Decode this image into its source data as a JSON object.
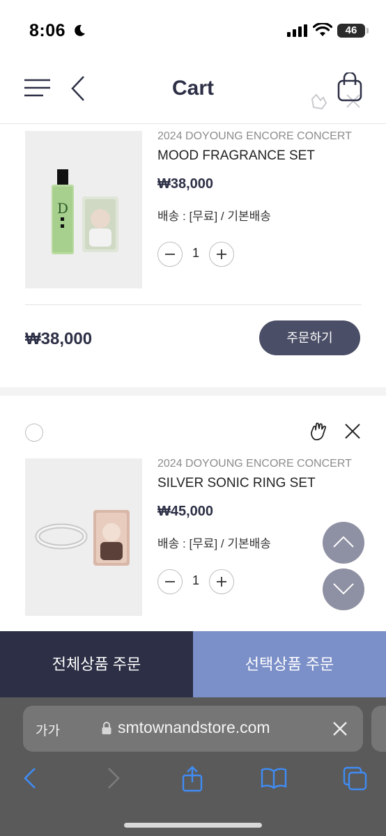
{
  "status_bar": {
    "time": "8:06",
    "battery": "46"
  },
  "header": {
    "title": "Cart"
  },
  "cart_items": [
    {
      "concert": "2024 DOYOUNG ENCORE CONCERT",
      "name": "MOOD FRAGRANCE SET",
      "price": "₩38,000",
      "shipping": "배송 : [무료] / 기본배송",
      "quantity": "1",
      "total": "₩38,000",
      "order_label": "주문하기"
    },
    {
      "concert": "2024 DOYOUNG ENCORE CONCERT",
      "name": "SILVER SONIC RING SET",
      "price": "₩45,000",
      "shipping": "배송 : [무료] / 기본배송",
      "quantity": "1"
    }
  ],
  "order_bar": {
    "order_all": "전체상품 주문",
    "order_selected": "선택상품 주문"
  },
  "browser": {
    "text_size": "가가",
    "url": "smtownandstore.com"
  },
  "colors": {
    "primary": "#2c2f45",
    "accent": "#7b8fc8",
    "scroll_button": "#8e90a3"
  }
}
